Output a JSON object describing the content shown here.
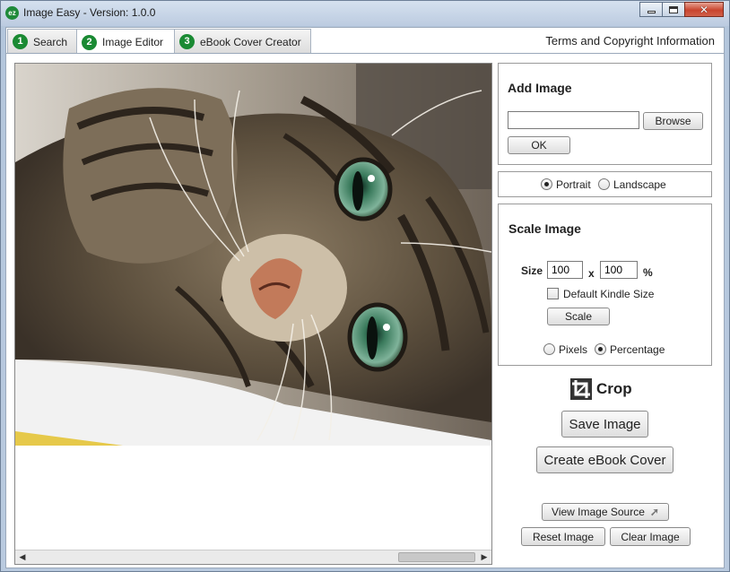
{
  "window": {
    "app_icon": "ez",
    "title": "Image Easy - Version: 1.0.0",
    "minimize_icon": "minimize-icon",
    "maximize_icon": "maximize-icon",
    "close_icon": "close-icon"
  },
  "tabs": [
    {
      "num": "1",
      "label": "Search",
      "active": false
    },
    {
      "num": "2",
      "label": "Image Editor",
      "active": true
    },
    {
      "num": "3",
      "label": "eBook Cover Creator",
      "active": false
    }
  ],
  "terms_link": "Terms and Copyright Information",
  "add_image": {
    "heading": "Add Image",
    "path_value": "",
    "browse_label": "Browse",
    "ok_label": "OK"
  },
  "orientation": {
    "portrait_label": "Portrait",
    "landscape_label": "Landscape",
    "selected": "Portrait"
  },
  "scale": {
    "heading": "Scale Image",
    "size_label": "Size",
    "width_value": "100",
    "x_label": "x",
    "height_value": "100",
    "unit_label": "%",
    "kindle_label": "Default Kindle Size",
    "kindle_checked": false,
    "scale_button": "Scale",
    "pixels_label": "Pixels",
    "percentage_label": "Percentage",
    "selected_unit": "Percentage"
  },
  "actions": {
    "crop_label": "Crop",
    "save_label": "Save Image",
    "create_cover_label": "Create eBook Cover",
    "view_source_label": "View Image Source",
    "reset_label": "Reset Image",
    "clear_label": "Clear Image"
  },
  "colors": {
    "tab_number_green": "#1a8a33",
    "close_button_red": "#c9452f",
    "titlebar_blue": "#bccbe0"
  }
}
